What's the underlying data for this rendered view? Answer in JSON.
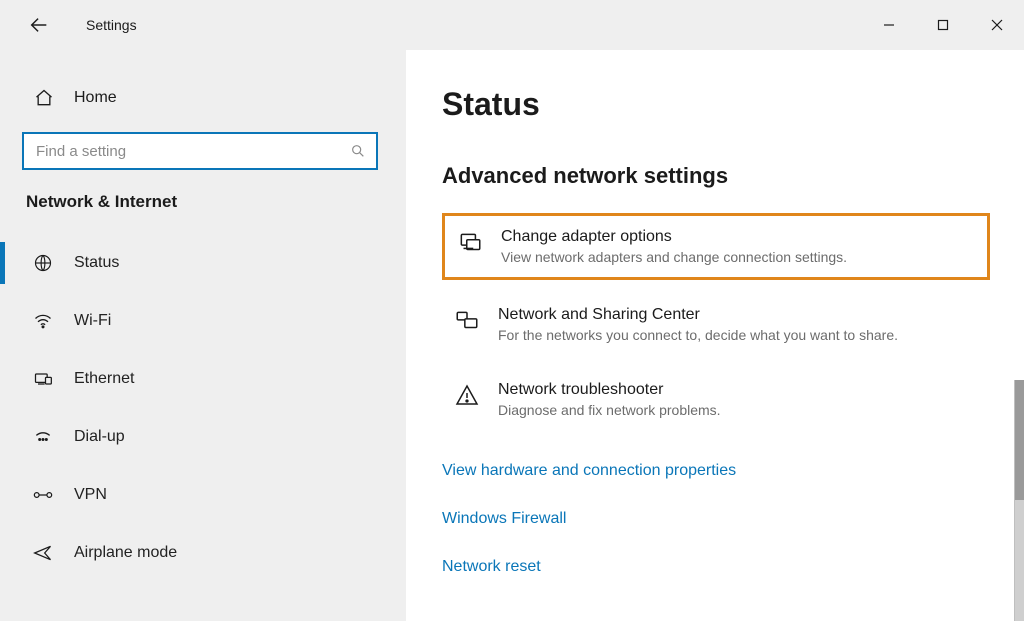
{
  "window": {
    "title": "Settings"
  },
  "sidebar": {
    "home_label": "Home",
    "search_placeholder": "Find a setting",
    "group_title": "Network & Internet",
    "items": [
      {
        "label": "Status"
      },
      {
        "label": "Wi-Fi"
      },
      {
        "label": "Ethernet"
      },
      {
        "label": "Dial-up"
      },
      {
        "label": "VPN"
      },
      {
        "label": "Airplane mode"
      }
    ]
  },
  "main": {
    "page_title": "Status",
    "section_title": "Advanced network settings",
    "options": [
      {
        "title": "Change adapter options",
        "desc": "View network adapters and change connection settings."
      },
      {
        "title": "Network and Sharing Center",
        "desc": "For the networks you connect to, decide what you want to share."
      },
      {
        "title": "Network troubleshooter",
        "desc": "Diagnose and fix network problems."
      }
    ],
    "links": [
      {
        "label": "View hardware and connection properties"
      },
      {
        "label": "Windows Firewall"
      },
      {
        "label": "Network reset"
      }
    ]
  }
}
